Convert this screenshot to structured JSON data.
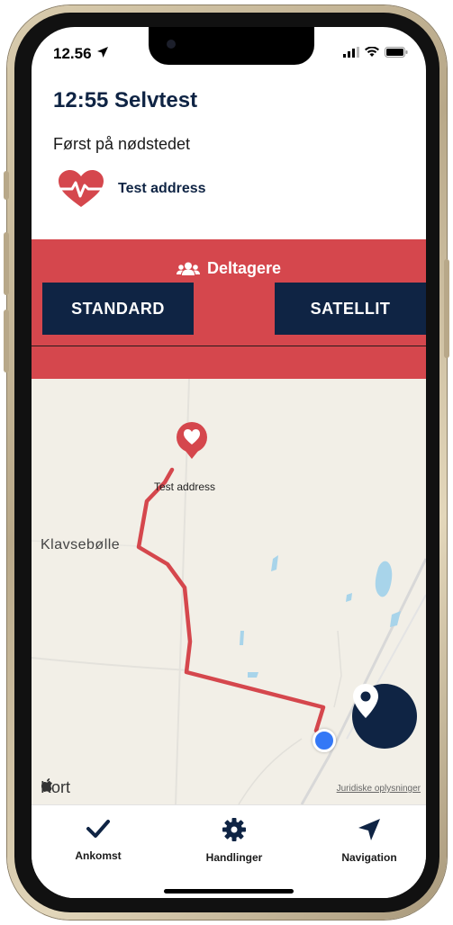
{
  "status_bar": {
    "time": "12.56"
  },
  "header": {
    "title": "12:55 Selvtest",
    "subtitle": "Først på nødstedet",
    "address": "Test address"
  },
  "band": {
    "participants_label": "Deltagere",
    "standard_label": "STANDARD",
    "satellite_label": "SATELLIT"
  },
  "map": {
    "pin_label": "Test address",
    "place_label": "Klavsebølle",
    "brand": "Kort",
    "legal": "Juridiske oplysninger"
  },
  "tabs": [
    {
      "label": "Ankomst",
      "icon": "checkmark-icon"
    },
    {
      "label": "Handlinger",
      "icon": "gear-icon"
    },
    {
      "label": "Navigation",
      "icon": "navigation-arrow-icon"
    }
  ],
  "colors": {
    "accent": "#0f2444",
    "band": "#d5474d",
    "route": "#d5474d",
    "user_location": "#3478f6"
  }
}
